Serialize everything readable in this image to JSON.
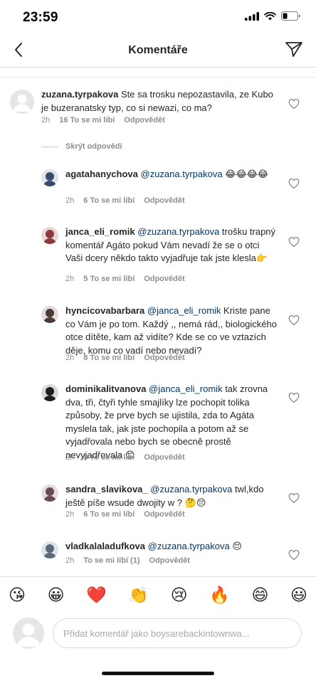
{
  "status_bar": {
    "time": "23:59"
  },
  "header": {
    "title": "Komentáře",
    "back_icon": "chevron-left-icon",
    "share_icon": "paper-plane-icon"
  },
  "main_comment": {
    "username": "zuzana.tyrpakova",
    "text": "Ste sa trosku nepozastavila, ze Kubo je buzeranatsky typ, co si newazi, co ma?",
    "time": "2h",
    "likes": "16 To se mi líbí",
    "reply": "Odpovědět"
  },
  "hide_replies_label": "Skrýt odpovědi",
  "replies": [
    {
      "username": "agatahanychova",
      "mention": "@zuzana.tyrpakova",
      "text": " 😂😂😂😂",
      "time": "2h",
      "likes": "6 To se mi líbí",
      "reply": "Odpovědět",
      "avatar_color": "#3a4a6a"
    },
    {
      "username": "janca_eli_romik",
      "mention": "@zuzana.tyrpakova",
      "text": "  trošku trapný komentář  Agáto pokud Vám nevadí že se o otci Vaši dcery někdo takto vyjadřuje tak jste klesla👉",
      "time": "2h",
      "likes": "5 To se mi líbí",
      "reply": "Odpovědět",
      "avatar_color": "#8a3a3a"
    },
    {
      "username": "hyncicovabarbara",
      "mention": "@janca_eli_romik",
      "text": " Kriste pane co Vám je po tom. Každý ,, nemá rád,, biologického otce dítěte, kam až vidíte? Kde se co ve vztazích děje, komu co vadí nebo nevadí?",
      "time": "2h",
      "likes": "8 To se mi líbí",
      "reply": "Odpovědět",
      "avatar_color": "#4a3a3a"
    },
    {
      "username": "dominikalitvanova",
      "mention": "@janca_eli_romik",
      "text": " tak zrovna dva, tři, čtyři tyhle smajlíky lze pochopit tolika způsoby, že prve bych se ujistila, zda to Agáta myslela tak, jak jste pochopila a potom až se vyjadřovala nebo bych se obecně prostě nevyjadřovala 😊",
      "time": "2h",
      "likes": "8 To se mi líbí",
      "reply": "Odpovědět",
      "avatar_color": "#1e1e1e"
    },
    {
      "username": "sandra_slavikova_",
      "mention": "@zuzana.tyrpakova",
      "text": " twl,kdo ještě píše wsude dwojity w ? 🤔😔",
      "time": "2h",
      "likes": "6 To se mi líbí",
      "reply": "Odpovědět",
      "avatar_color": "#6a4a5a"
    },
    {
      "username": "vladkalaladufkova",
      "mention": "@zuzana.tyrpakova",
      "text": " 😔",
      "time": "2h",
      "likes": "To se mi líbí (1)",
      "reply": "Odpovědět",
      "avatar_color": "#5a6a7a"
    }
  ],
  "emoji_bar": [
    "😘",
    "😀",
    "❤️",
    "👏",
    "😢",
    "🔥",
    "😄",
    "😃"
  ],
  "comment_input": {
    "placeholder": "Přidat komentář jako boysarebackintownwa..."
  }
}
